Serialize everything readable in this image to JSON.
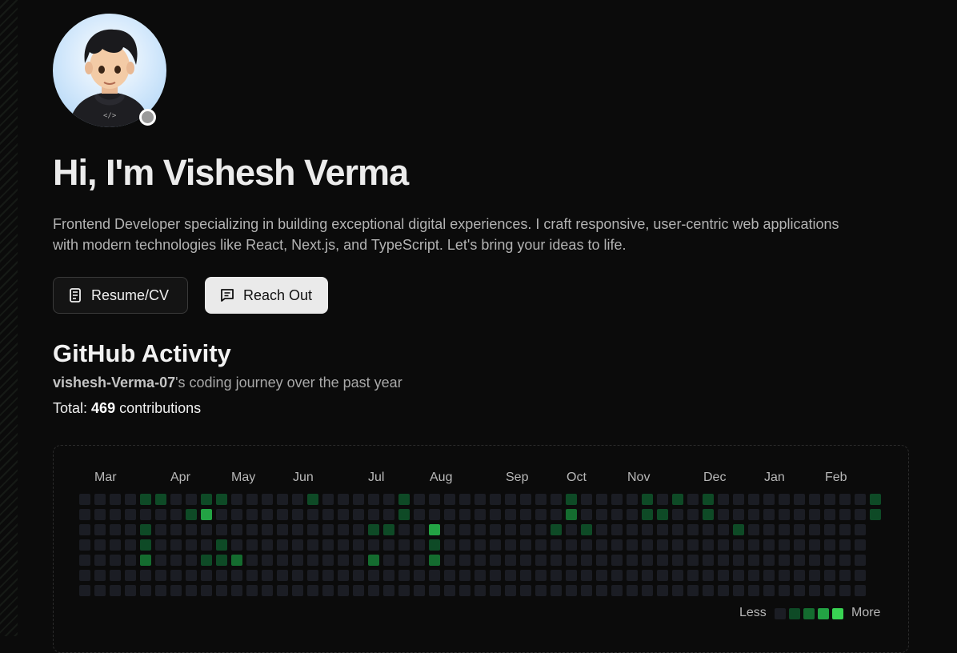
{
  "profile": {
    "greeting": "Hi, I'm Vishesh Verma",
    "bio": "Frontend Developer specializing in building exceptional digital experiences. I craft responsive, user-centric web applications with modern technologies like React, Next.js, and TypeScript. Let's bring your ideas to life.",
    "status_color": "#9a9a9a"
  },
  "buttons": {
    "resume_label": "Resume/CV",
    "resume_icon": "document-icon",
    "reach_label": "Reach Out",
    "reach_icon": "message-icon"
  },
  "github": {
    "title": "GitHub Activity",
    "username": "vishesh-Verma-07",
    "journey_suffix": "'s coding journey over the past year",
    "total_prefix": "Total:",
    "total_count": "469",
    "total_suffix": "contributions",
    "months": [
      "Mar",
      "Apr",
      "May",
      "Jun",
      "Jul",
      "Aug",
      "Sep",
      "Oct",
      "Nov",
      "Dec",
      "Jan",
      "Feb"
    ],
    "legend_less": "Less",
    "legend_more": "More",
    "level_colors": [
      "#1b1d24",
      "#0e4a26",
      "#146c2f",
      "#23a344",
      "#39d353"
    ],
    "heatmap": [
      "0000110011000001000001000000000010000101010000000000101000000000000000003011311030000000220030101001000310",
      "0000000130000000000001000000000020000110010000000000100000000000000000000000000000000000030011001110000100",
      "0000100000000000000110030000000101000000000100000000001100000000000000000000000000000000000011111100100000",
      "0000100001000000000000010000000000000000000000000000000000000000000000000000000000000000000000000000000000",
      "0000200011200000000200020000000000000000000000000000000000000000000000000000000000000000000000000000000000",
      "0000000000000000000000000000000000000000000000000000000000000000000000000000000000000000000000000000000000"
    ]
  }
}
